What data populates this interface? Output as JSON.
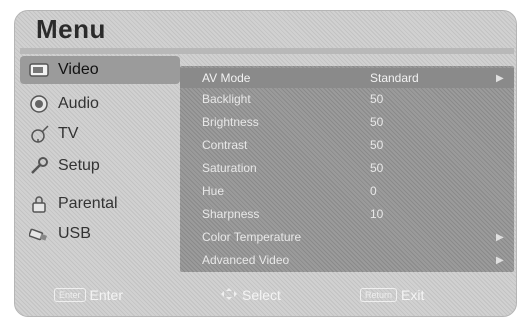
{
  "header": {
    "title": "Menu"
  },
  "sidebar": {
    "items": [
      {
        "label": "Video",
        "icon": "video-icon"
      },
      {
        "label": "Audio",
        "icon": "audio-icon"
      },
      {
        "label": "TV",
        "icon": "antenna-icon"
      },
      {
        "label": "Setup",
        "icon": "setup-icon"
      },
      {
        "label": "Parental",
        "icon": "lock-icon"
      },
      {
        "label": "USB",
        "icon": "usb-icon"
      }
    ]
  },
  "video": {
    "rows": [
      {
        "label": "AV Mode",
        "value": "Standard",
        "arrow": "▶"
      },
      {
        "label": "Backlight",
        "value": "50",
        "arrow": ""
      },
      {
        "label": "Brightness",
        "value": "50",
        "arrow": ""
      },
      {
        "label": "Contrast",
        "value": "50",
        "arrow": ""
      },
      {
        "label": "Saturation",
        "value": "50",
        "arrow": ""
      },
      {
        "label": "Hue",
        "value": "0",
        "arrow": ""
      },
      {
        "label": "Sharpness",
        "value": "10",
        "arrow": ""
      },
      {
        "label": "Color Temperature",
        "value": "",
        "arrow": "▶"
      },
      {
        "label": "Advanced Video",
        "value": "",
        "arrow": "▶"
      }
    ]
  },
  "footer": {
    "enter_key": "Enter",
    "enter_label": "Enter",
    "select_icon": "dpad-icon",
    "select_label": "Select",
    "return_key": "Return",
    "exit_label": "Exit"
  }
}
